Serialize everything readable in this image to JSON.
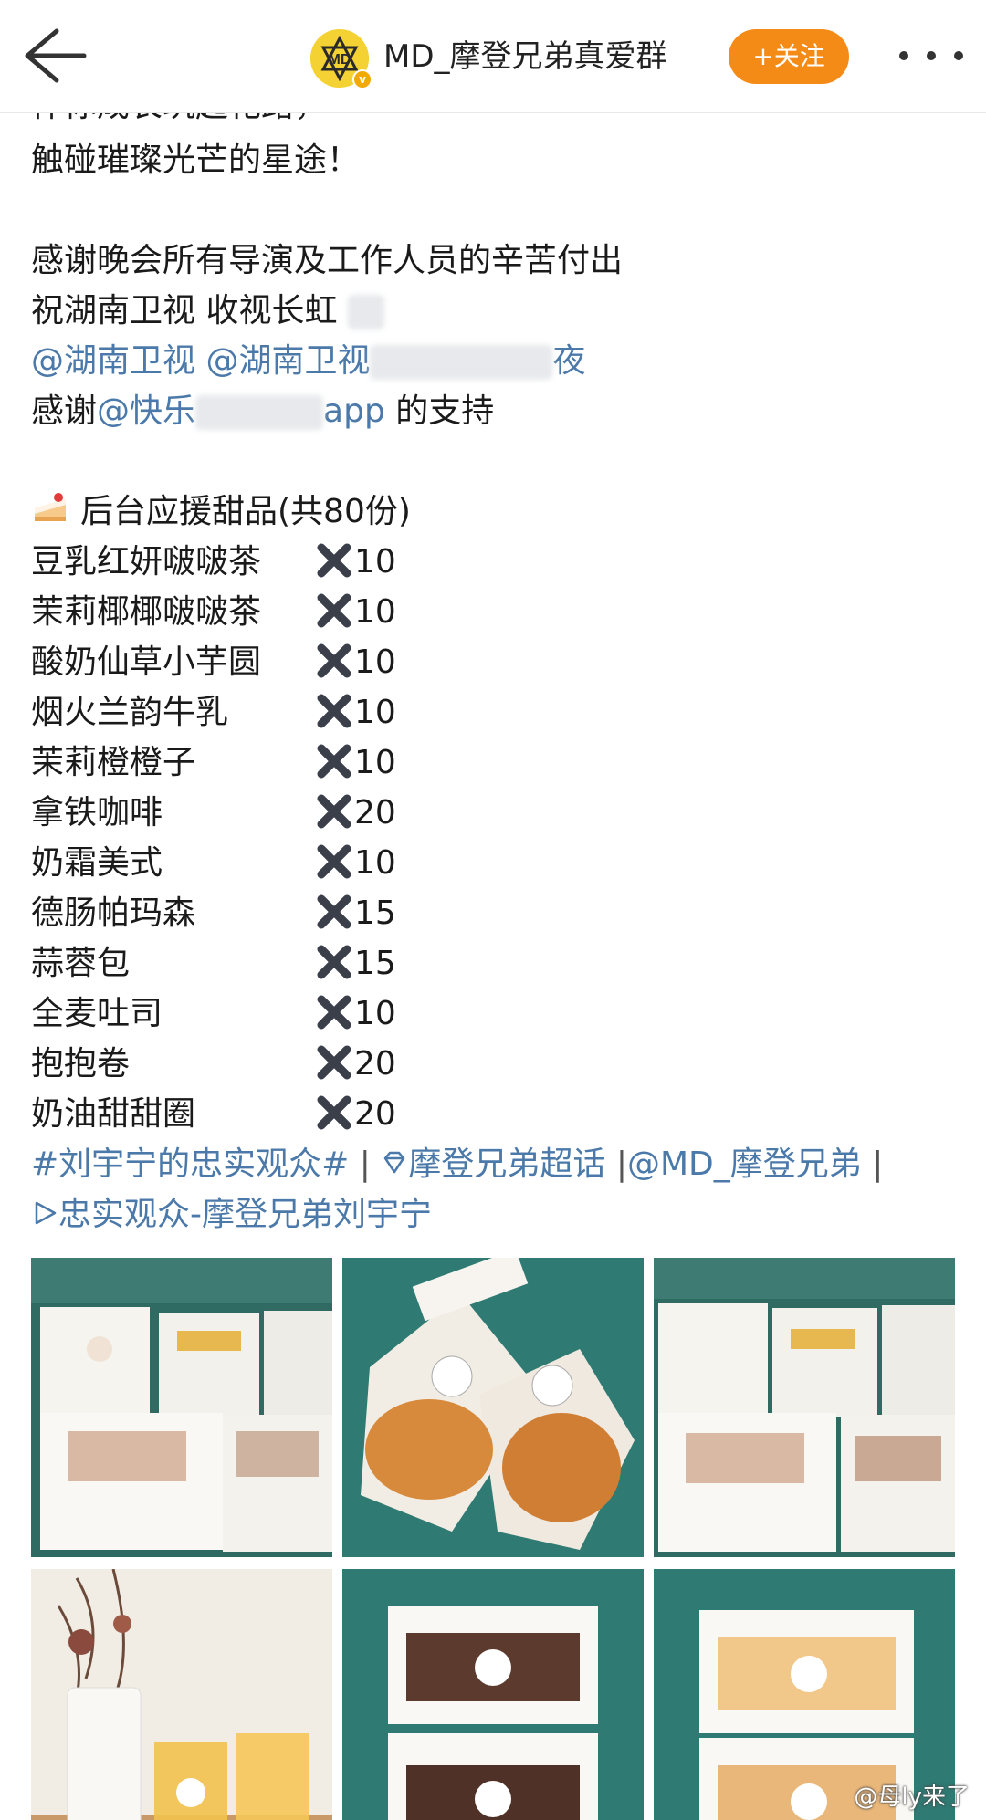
{
  "header": {
    "title": "MD_摩登兄弟真爱群",
    "follow_label": "+关注",
    "avatar_text": "MD"
  },
  "post": {
    "lines_top": [
      "伴你成长筑起花路，",
      "触碰璀璨光芒的星途！"
    ],
    "thanks_line": "感谢晚会所有导演及工作人员的辛苦付出",
    "wish_line": "祝湖南卫视 收视长虹",
    "mention_1": "@湖南卫视",
    "mention_2": "@湖南卫视",
    "mention_2_tail": "夜",
    "support_prefix": "感谢",
    "support_mention": "@快乐",
    "support_app": "app",
    "support_suffix": " 的支持",
    "dessert_heading": "后台应援甜品(共80份)",
    "items": [
      {
        "name": "豆乳红妍啵啵茶",
        "qty": "10"
      },
      {
        "name": "茉莉椰椰啵啵茶",
        "qty": "10"
      },
      {
        "name": "酸奶仙草小芋圆",
        "qty": "10"
      },
      {
        "name": "烟火兰韵牛乳",
        "qty": "10"
      },
      {
        "name": "茉莉橙橙子",
        "qty": "10"
      },
      {
        "name": "拿铁咖啡",
        "qty": "20"
      },
      {
        "name": "奶霜美式",
        "qty": "10"
      },
      {
        "name": "德肠帕玛森",
        "qty": "15"
      },
      {
        "name": "蒜蓉包",
        "qty": "15"
      },
      {
        "name": "全麦吐司",
        "qty": "10"
      },
      {
        "name": "抱抱卷",
        "qty": "20"
      },
      {
        "name": "奶油甜甜圈",
        "qty": "20"
      }
    ],
    "tag_topic": "#刘宇宁的忠实观众#",
    "tag_supertopic": "摩登兄弟超话",
    "tag_mention": "@MD_摩登兄弟",
    "tag_video": "忠实观众-摩登兄弟刘宇宁"
  },
  "watermark": "@母ly来了",
  "colors": {
    "link": "#4b79a9",
    "follow": "#f58b17",
    "avatar": "#f4d233"
  }
}
